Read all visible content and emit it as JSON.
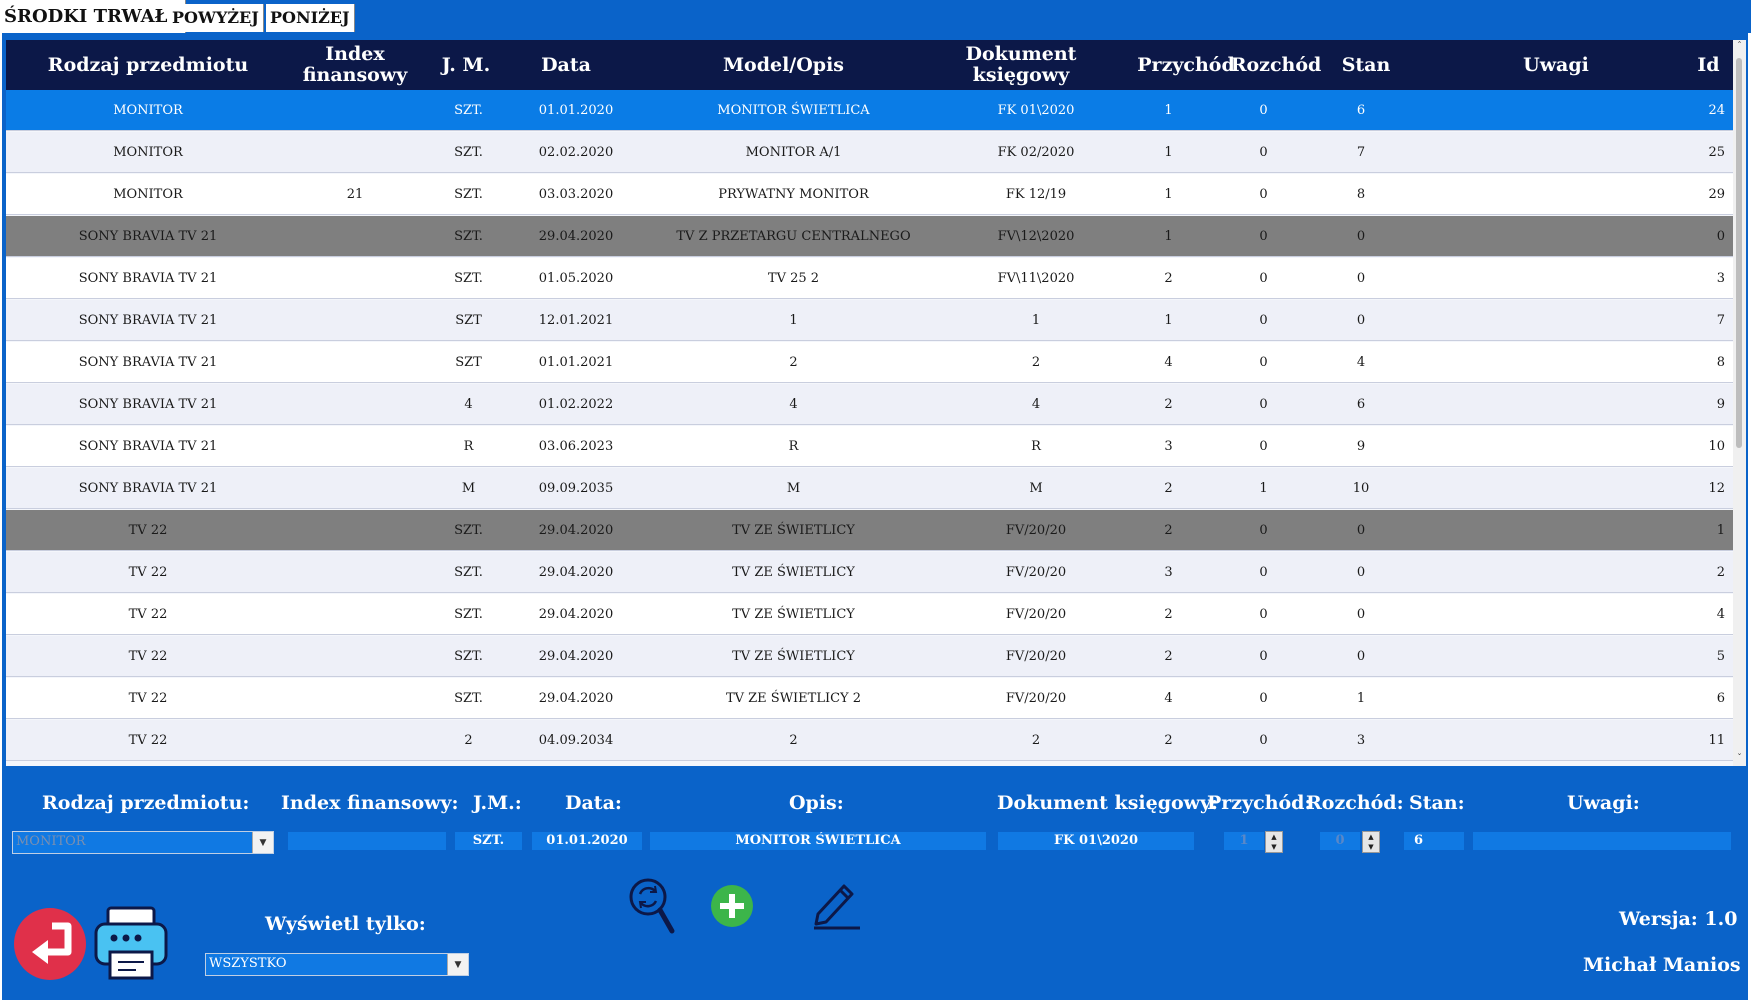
{
  "tabs": [
    {
      "label": "ŚRODKI TRWAŁE",
      "active": true
    },
    {
      "label": "POWYŻEJ",
      "active": false
    },
    {
      "label": "PONIŻEJ",
      "active": false
    }
  ],
  "grid": {
    "headers": {
      "rodzaj": "Rodzaj przedmiotu",
      "index": "Index finansowy",
      "jm": "J. M.",
      "data": "Data",
      "model": "Model/Opis",
      "dokument": "Dokument księgowy",
      "przychod": "Przychód",
      "rozchod": "Rozchód",
      "stan": "Stan",
      "uwagi": "Uwagi",
      "id": "Id"
    },
    "rows": [
      {
        "rodzaj": "MONITOR",
        "index": "",
        "jm": "SZT.",
        "data": "01.01.2020",
        "model": "MONITOR ŚWIETLICA",
        "dokument": "FK 01\\2020",
        "przychod": "1",
        "rozchod": "0",
        "stan": "6",
        "uwagi": "",
        "id": "24",
        "style": "selected"
      },
      {
        "rodzaj": "MONITOR",
        "index": "",
        "jm": "SZT.",
        "data": "02.02.2020",
        "model": "MONITOR A/1",
        "dokument": "FK 02/2020",
        "przychod": "1",
        "rozchod": "0",
        "stan": "7",
        "uwagi": "",
        "id": "25",
        "style": "even"
      },
      {
        "rodzaj": "MONITOR",
        "index": "21",
        "jm": "SZT.",
        "data": "03.03.2020",
        "model": "PRYWATNY MONITOR",
        "dokument": "FK 12/19",
        "przychod": "1",
        "rozchod": "0",
        "stan": "8",
        "uwagi": "",
        "id": "29",
        "style": "odd"
      },
      {
        "rodzaj": "SONY BRAVIA TV 21",
        "index": "",
        "jm": "SZT.",
        "data": "29.04.2020",
        "model": "TV Z PRZETARGU CENTRALNEGO",
        "dokument": "FV\\12\\2020",
        "przychod": "1",
        "rozchod": "0",
        "stan": "0",
        "uwagi": "",
        "id": "0",
        "style": "dark"
      },
      {
        "rodzaj": "SONY BRAVIA TV 21",
        "index": "",
        "jm": "SZT.",
        "data": "01.05.2020",
        "model": "TV 25 2",
        "dokument": "FV\\11\\2020",
        "przychod": "2",
        "rozchod": "0",
        "stan": "0",
        "uwagi": "",
        "id": "3",
        "style": "odd"
      },
      {
        "rodzaj": "SONY BRAVIA TV 21",
        "index": "",
        "jm": "SZT",
        "data": "12.01.2021",
        "model": "1",
        "dokument": "1",
        "przychod": "1",
        "rozchod": "0",
        "stan": "0",
        "uwagi": "",
        "id": "7",
        "style": "even"
      },
      {
        "rodzaj": "SONY BRAVIA TV 21",
        "index": "",
        "jm": "SZT",
        "data": "01.01.2021",
        "model": "2",
        "dokument": "2",
        "przychod": "4",
        "rozchod": "0",
        "stan": "4",
        "uwagi": "",
        "id": "8",
        "style": "odd"
      },
      {
        "rodzaj": "SONY BRAVIA TV 21",
        "index": "",
        "jm": "4",
        "data": "01.02.2022",
        "model": "4",
        "dokument": "4",
        "przychod": "2",
        "rozchod": "0",
        "stan": "6",
        "uwagi": "",
        "id": "9",
        "style": "even"
      },
      {
        "rodzaj": "SONY BRAVIA TV 21",
        "index": "",
        "jm": "R",
        "data": "03.06.2023",
        "model": "R",
        "dokument": "R",
        "przychod": "3",
        "rozchod": "0",
        "stan": "9",
        "uwagi": "",
        "id": "10",
        "style": "odd"
      },
      {
        "rodzaj": "SONY BRAVIA TV 21",
        "index": "",
        "jm": "M",
        "data": "09.09.2035",
        "model": "M",
        "dokument": "M",
        "przychod": "2",
        "rozchod": "1",
        "stan": "10",
        "uwagi": "",
        "id": "12",
        "style": "even"
      },
      {
        "rodzaj": "TV 22",
        "index": "",
        "jm": "SZT.",
        "data": "29.04.2020",
        "model": "TV ZE ŚWIETLICY",
        "dokument": "FV/20/20",
        "przychod": "2",
        "rozchod": "0",
        "stan": "0",
        "uwagi": "",
        "id": "1",
        "style": "dark"
      },
      {
        "rodzaj": "TV 22",
        "index": "",
        "jm": "SZT.",
        "data": "29.04.2020",
        "model": "TV ZE ŚWIETLICY",
        "dokument": "FV/20/20",
        "przychod": "3",
        "rozchod": "0",
        "stan": "0",
        "uwagi": "",
        "id": "2",
        "style": "even"
      },
      {
        "rodzaj": "TV 22",
        "index": "",
        "jm": "SZT.",
        "data": "29.04.2020",
        "model": "TV ZE ŚWIETLICY",
        "dokument": "FV/20/20",
        "przychod": "2",
        "rozchod": "0",
        "stan": "0",
        "uwagi": "",
        "id": "4",
        "style": "odd"
      },
      {
        "rodzaj": "TV 22",
        "index": "",
        "jm": "SZT.",
        "data": "29.04.2020",
        "model": "TV ZE ŚWIETLICY",
        "dokument": "FV/20/20",
        "przychod": "2",
        "rozchod": "0",
        "stan": "0",
        "uwagi": "",
        "id": "5",
        "style": "even"
      },
      {
        "rodzaj": "TV 22",
        "index": "",
        "jm": "SZT.",
        "data": "29.04.2020",
        "model": "TV ZE ŚWIETLICY 2",
        "dokument": "FV/20/20",
        "przychod": "4",
        "rozchod": "0",
        "stan": "1",
        "uwagi": "",
        "id": "6",
        "style": "odd"
      },
      {
        "rodzaj": "TV 22",
        "index": "",
        "jm": "2",
        "data": "04.09.2034",
        "model": "2",
        "dokument": "2",
        "przychod": "2",
        "rozchod": "0",
        "stan": "3",
        "uwagi": "",
        "id": "11",
        "style": "even"
      }
    ]
  },
  "form": {
    "labels": {
      "rodzaj": "Rodzaj przedmiotu:",
      "index": "Index finansowy:",
      "jm": "J.M.:",
      "data": "Data:",
      "opis": "Opis:",
      "dokument": "Dokument księgowy:",
      "przychod": "Przychód:",
      "rozchod": "Rozchód:",
      "stan": "Stan:",
      "uwagi": "Uwagi:"
    },
    "values": {
      "rodzaj": "MONITOR",
      "index": "",
      "jm": "SZT.",
      "data": "01.01.2020",
      "opis": "MONITOR ŚWIETLICA",
      "dokument": "FK 01\\2020",
      "przychod": "1",
      "rozchod": "0",
      "stan": "6",
      "uwagi": ""
    }
  },
  "filter": {
    "label": "Wyświetl tylko:",
    "value": "WSZYSTKO"
  },
  "footer": {
    "version": "Wersja: 1.0",
    "author": "Michał Manios"
  },
  "icons": {
    "back": "back-arrow-icon",
    "print": "printer-icon",
    "search": "search-refresh-icon",
    "add": "add-icon",
    "edit": "edit-pencil-icon"
  },
  "colors": {
    "accent": "#0a63c9",
    "header": "#0c1848",
    "selected_row": "#0a7ce6",
    "dark_row": "#7f7f7f",
    "add_green": "#3cb54a",
    "back_red": "#e0304a"
  }
}
